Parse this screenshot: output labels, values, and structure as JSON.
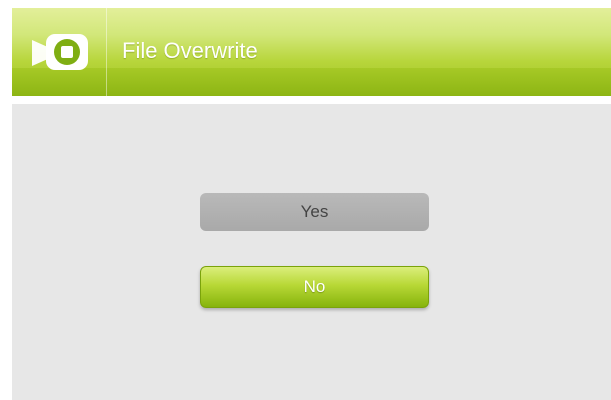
{
  "header": {
    "title": "File Overwrite",
    "icon": "video-camera-icon"
  },
  "dialog": {
    "yes_label": "Yes",
    "no_label": "No",
    "selected": "No"
  },
  "colors": {
    "accent": "#a6cb1f",
    "content_bg": "#e7e7e7",
    "unselected_button": "#b1b1b1"
  }
}
